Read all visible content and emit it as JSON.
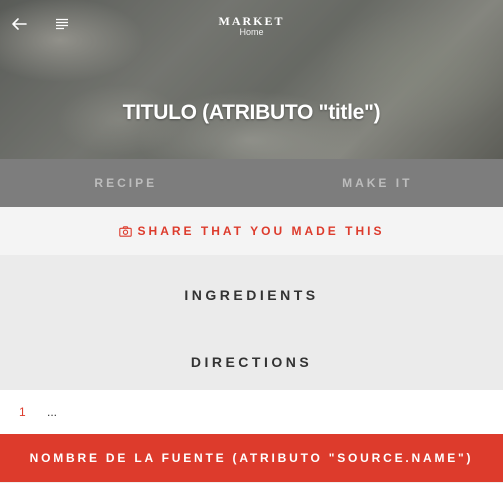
{
  "header": {
    "brand_title": "MARKET",
    "brand_subtitle": "Home",
    "back_icon": "arrow-left-icon",
    "menu_icon": "menu-lines-icon"
  },
  "hero": {
    "title": "TITULO (ATRIBUTO \"title\")"
  },
  "tabs": [
    {
      "label": "RECIPE"
    },
    {
      "label": "MAKE IT"
    }
  ],
  "share": {
    "icon": "camera-icon",
    "label": "SHARE THAT YOU MADE THIS"
  },
  "sections": {
    "ingredients": "INGREDIENTS",
    "directions": "DIRECTIONS"
  },
  "steps": [
    {
      "number": "1",
      "text": "..."
    }
  ],
  "source_button": {
    "label": "NOMBRE DE LA FUENTE (ATRIBUTO \"SOURCE.NAME\")"
  },
  "colors": {
    "accent": "#dd3b2c",
    "tab_bar": "#7d7d7d",
    "section_bg": "#ebebeb",
    "share_bg": "#f4f4f4"
  }
}
